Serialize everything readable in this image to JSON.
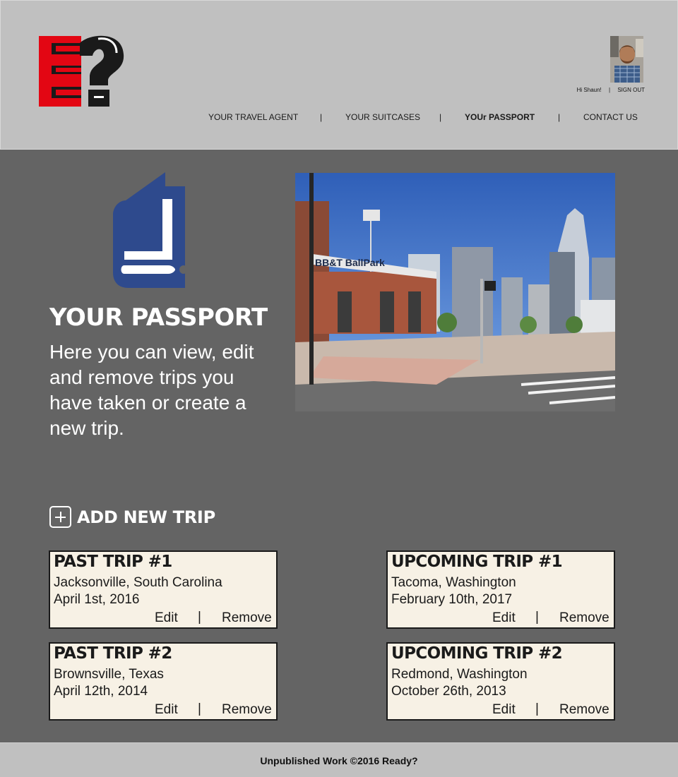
{
  "brand": {
    "logo_letters": "E?",
    "colors": {
      "logo_red": "#e30613",
      "logo_black": "#1a1a1a"
    }
  },
  "user": {
    "greeting": "Hi Shaun!",
    "separator": "|",
    "sign_out_label": "SIGN OUT",
    "avatar_icon": "user-avatar-photo"
  },
  "nav": {
    "items": [
      {
        "label": "YOUR TRAVEL AGENT",
        "active": false
      },
      {
        "label": "YOUR SUITCASES",
        "active": false
      },
      {
        "label": "YOUr PASSPORT",
        "active": true
      },
      {
        "label": "CONTACT US",
        "active": false
      }
    ],
    "separator": "|"
  },
  "hero": {
    "icon": "passport-book-icon",
    "title": "YOUR PASSPORT",
    "description": "Here you can view, edit and remove trips you have taken or create a new trip.",
    "photo_sign_text": "BB&T BallPark"
  },
  "add_trip": {
    "icon": "plus-box-icon",
    "label": "ADD NEW TRIP"
  },
  "trips": {
    "past": [
      {
        "title": "PAST TRIP #1",
        "location": "Jacksonville, South Carolina",
        "date": "April 1st, 2016",
        "edit_label": "Edit",
        "separator": "|",
        "remove_label": "Remove"
      },
      {
        "title": "PAST TRIP #2",
        "location": "Brownsville, Texas",
        "date": "April 12th, 2014",
        "edit_label": "Edit",
        "separator": "|",
        "remove_label": "Remove"
      }
    ],
    "upcoming": [
      {
        "title": "UPCOMING TRIP #1",
        "location": "Tacoma, Washington",
        "date": "February 10th, 2017",
        "edit_label": "Edit",
        "separator": "|",
        "remove_label": "Remove"
      },
      {
        "title": "UPCOMING TRIP #2",
        "location": "Redmond, Washington",
        "date": "October 26th, 2013",
        "edit_label": "Edit",
        "separator": "|",
        "remove_label": "Remove"
      }
    ]
  },
  "footer": {
    "text": "Unpublished Work ©2016 Ready?"
  },
  "theme": {
    "header_bg": "#c0c0c0",
    "page_bg": "#646464",
    "card_bg": "#f7f1e5",
    "book_blue": "#2e4a8d"
  }
}
